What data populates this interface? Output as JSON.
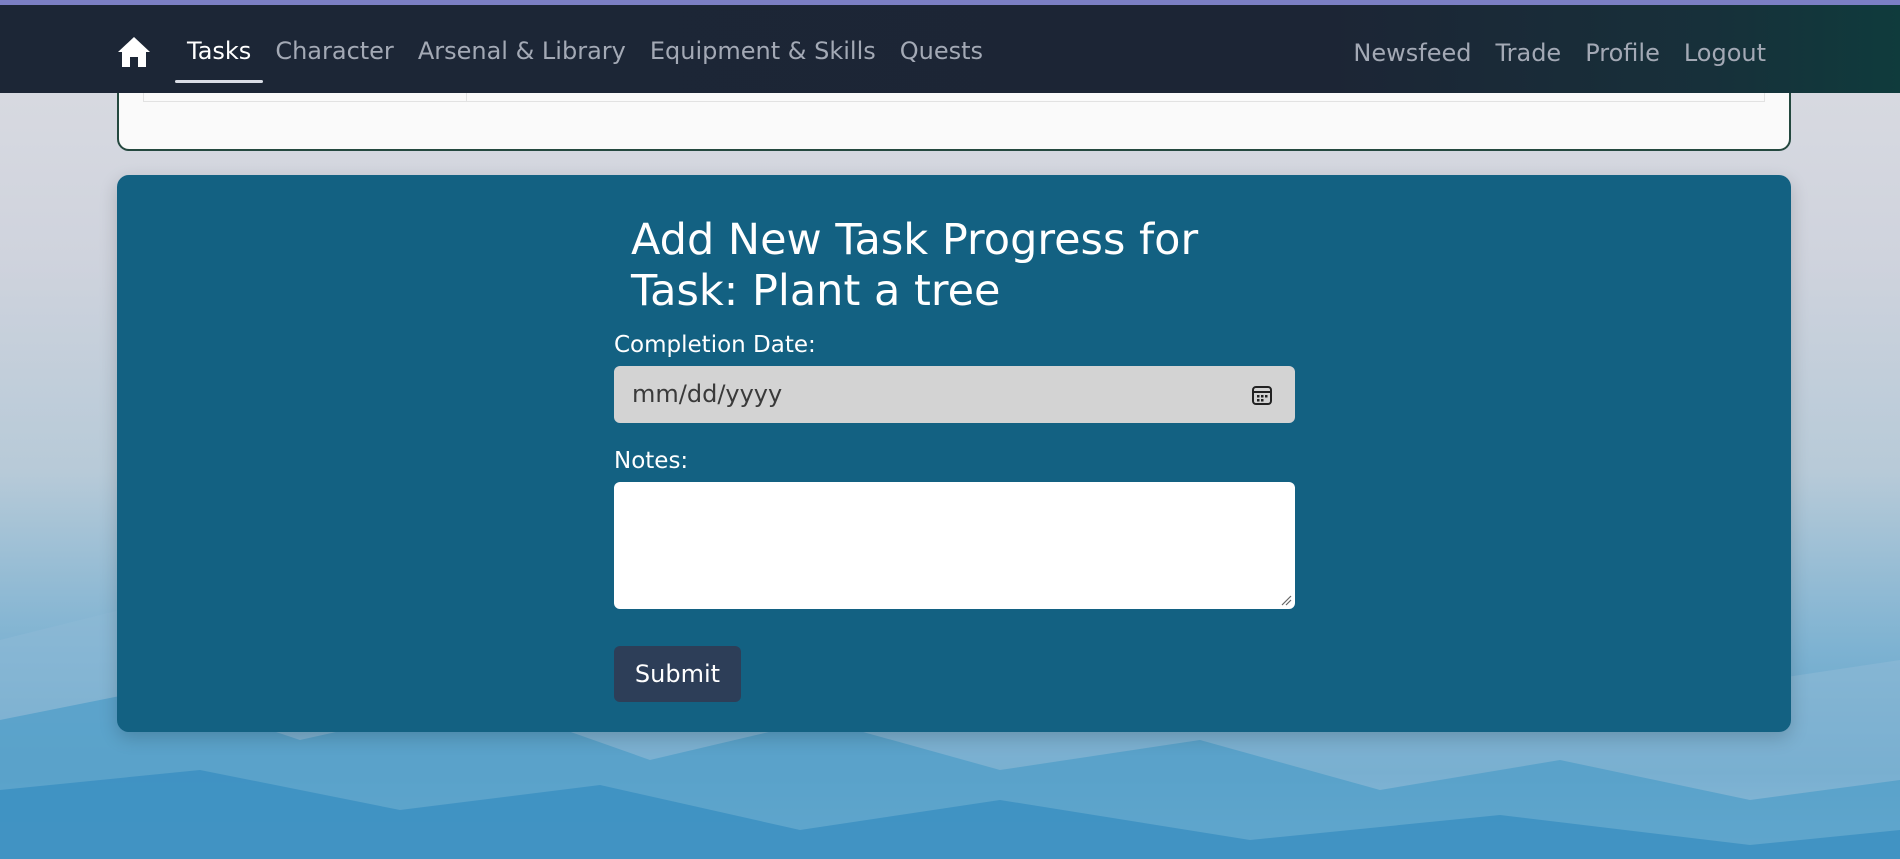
{
  "nav": {
    "home_icon": "home-icon",
    "left_items": [
      "Tasks",
      "Character",
      "Arsenal & Library",
      "Equipment & Skills",
      "Quests"
    ],
    "active_item": "Tasks",
    "right_items": [
      "Newsfeed",
      "Trade",
      "Profile",
      "Logout"
    ]
  },
  "form": {
    "title": "Add New Task Progress for Task: Plant a tree",
    "completion_date_label": "Completion Date:",
    "completion_date_placeholder": "mm/dd/yyyy",
    "calendar_icon": "calendar-icon",
    "notes_label": "Notes:",
    "notes_value": "",
    "submit_label": "Submit"
  },
  "colors": {
    "topbar": "#1c2636",
    "panel": "#136182",
    "submit_button": "#2d3e58",
    "date_input": "#d3d3d3"
  }
}
